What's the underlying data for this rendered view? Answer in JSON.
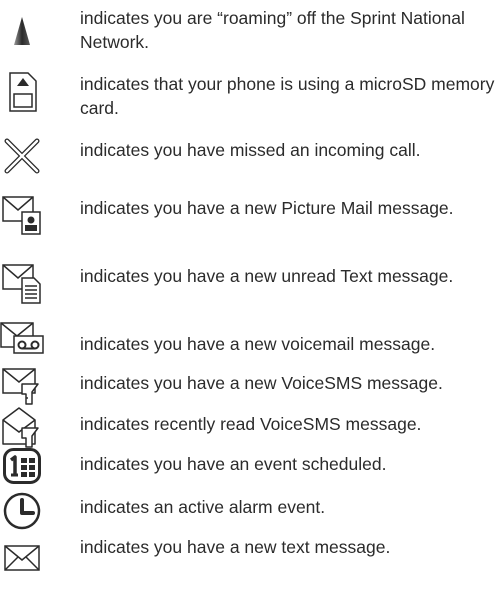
{
  "icons": [
    {
      "icon": "roaming-triangle-icon",
      "text": "indicates you are “roaming” off the Sprint National Network."
    },
    {
      "icon": "microsd-card-icon",
      "text": "indicates that your phone is using a microSD memory card."
    },
    {
      "icon": "missed-call-icon",
      "text": "indicates you have missed an incoming call."
    },
    {
      "icon": "picture-mail-icon",
      "text": "indicates you have a new Picture Mail message."
    },
    {
      "icon": "unread-text-message-icon",
      "text": "indicates you have a new unread Text message."
    },
    {
      "icon": "voicemail-icon",
      "text": "indicates you have a new voicemail message."
    },
    {
      "icon": "voicesms-icon",
      "text": "indicates you have a new VoiceSMS message."
    },
    {
      "icon": "read-voicesms-icon",
      "text": "indicates recently read VoiceSMS message."
    },
    {
      "icon": "event-scheduled-icon",
      "text": "indicates you have an event scheduled."
    },
    {
      "icon": "alarm-clock-icon",
      "text": "indicates an active alarm event."
    },
    {
      "icon": "text-message-envelope-icon",
      "text": "indicates you have a new text message."
    }
  ],
  "colors": {
    "text": "#2b2b2b",
    "icon_stroke": "#2b2b2b"
  }
}
